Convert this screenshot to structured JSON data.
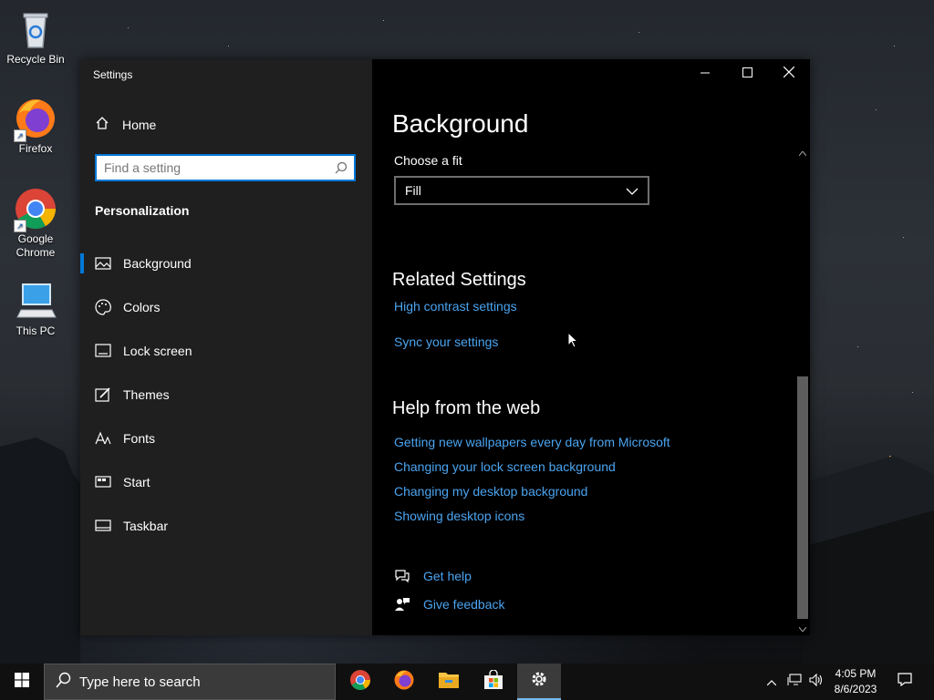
{
  "desktop": {
    "icons": [
      {
        "label": "Recycle Bin"
      },
      {
        "label": "Firefox"
      },
      {
        "label": "Google Chrome"
      },
      {
        "label": "This PC"
      }
    ]
  },
  "window": {
    "title": "Settings",
    "controls": [
      "minimize-icon",
      "maximize-icon",
      "close-icon"
    ]
  },
  "sidebar": {
    "home_label": "Home",
    "search_placeholder": "Find a setting",
    "section_title": "Personalization",
    "items": [
      {
        "label": "Background",
        "icon": "picture-icon",
        "active": true
      },
      {
        "label": "Colors",
        "icon": "palette-icon"
      },
      {
        "label": "Lock screen",
        "icon": "lock-screen-icon"
      },
      {
        "label": "Themes",
        "icon": "brush-icon"
      },
      {
        "label": "Fonts",
        "icon": "font-icon"
      },
      {
        "label": "Start",
        "icon": "start-icon"
      },
      {
        "label": "Taskbar",
        "icon": "taskbar-icon"
      }
    ]
  },
  "main": {
    "page_title": "Background",
    "fit_label": "Choose a fit",
    "fit_value": "Fill",
    "related_title": "Related Settings",
    "related_links": [
      "High contrast settings",
      "Sync your settings"
    ],
    "help_title": "Help from the web",
    "help_links": [
      "Getting new wallpapers every day from Microsoft",
      "Changing your lock screen background",
      "Changing my desktop background",
      "Showing desktop icons"
    ],
    "get_help": "Get help",
    "give_feedback": "Give feedback"
  },
  "taskbar": {
    "search_placeholder": "Type here to search",
    "apps": [
      "chrome-icon",
      "firefox-icon",
      "file-explorer-icon",
      "store-icon",
      "settings-icon"
    ],
    "time": "4:05 PM",
    "date": "8/6/2023"
  },
  "colors": {
    "accent": "#0078d7",
    "link": "#4aa4f0",
    "sidebar_bg": "#1f1f1f",
    "content_bg": "#000000"
  }
}
